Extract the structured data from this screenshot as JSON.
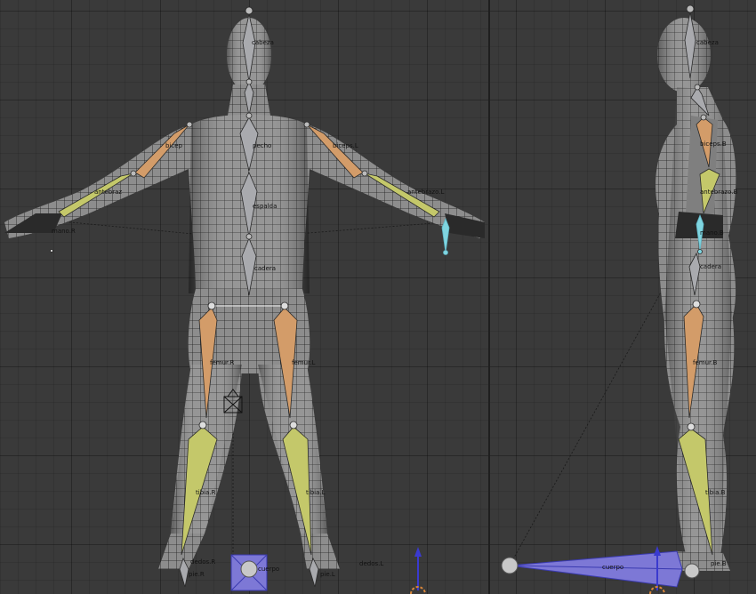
{
  "bones_front": {
    "cabeza": "cabeza",
    "pecho": "pecho",
    "espalda": "espalda",
    "cadera": "cadera",
    "biceps_R": "bicep",
    "biceps_L": "biceps.L",
    "antebrazo_R": "antebraz",
    "antebrazo_L": "antebrazo.L",
    "mano_R": "mano.R",
    "femur_R": "femur.R",
    "femur_L": "femur.L",
    "tibia_R": "tibia.R",
    "tibia_L": "tibia.L",
    "pie_R": "pie.R",
    "pie_L": "pie.L",
    "dedos_R": "dedos.R",
    "dedos_L": "dedos.L",
    "cuerpo": "cuerpo"
  },
  "bones_side": {
    "cabeza": "cabeza",
    "biceps": "biceps.B",
    "antebrazo": "antebrazo.B",
    "mano": "mano.B",
    "cadera": "cadera",
    "femur": "femur.B",
    "tibia": "tibia.B",
    "pie": "pie.B",
    "cuerpo": "cuerpo"
  },
  "colors": {
    "background": "#3a3a3a",
    "mesh_fill": "#8f8f8f",
    "wire": "#1a1a1a",
    "bone_default": "#a9aaae",
    "bone_upper": "#d39c69",
    "bone_lower": "#c4c86a",
    "bone_selected": "#7fd5e0",
    "root_bone": "#7d78d6",
    "axis_blue": "#3a3acf",
    "cursor": "#d9863a"
  }
}
